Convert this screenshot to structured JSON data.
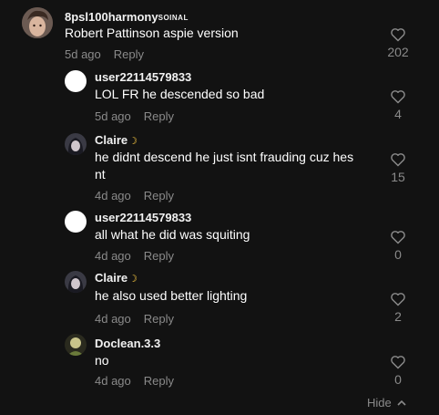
{
  "comments": [
    {
      "username": "8psl100harmony",
      "badge": "SOINAL",
      "text": "Robert Pattinson aspie version",
      "time": "5d ago",
      "reply_label": "Reply",
      "likes": "202"
    }
  ],
  "replies": [
    {
      "username": "user22114579833",
      "text": "LOL FR he descended so bad",
      "time": "5d ago",
      "reply_label": "Reply",
      "likes": "4"
    },
    {
      "username": "Claire",
      "emoji": "moon",
      "text_line1": "he didnt descend he just isnt frauding cuz hes",
      "text_line2": "nt",
      "time": "4d ago",
      "reply_label": "Reply",
      "likes": "15"
    },
    {
      "username": "user22114579833",
      "text": "all what he did was squiting",
      "time": "4d ago",
      "reply_label": "Reply",
      "likes": "0"
    },
    {
      "username": "Claire",
      "emoji": "moon",
      "text": "he also used better lighting",
      "time": "4d ago",
      "reply_label": "Reply",
      "likes": "2"
    },
    {
      "username": "Doclean.3.3",
      "text": "no",
      "time": "4d ago",
      "reply_label": "Reply",
      "likes": "0"
    }
  ],
  "hide_label": "Hide",
  "colors": {
    "background": "#121212",
    "muted": "#8a8a8a",
    "text": "#ffffff",
    "moon": "#f5c542"
  }
}
